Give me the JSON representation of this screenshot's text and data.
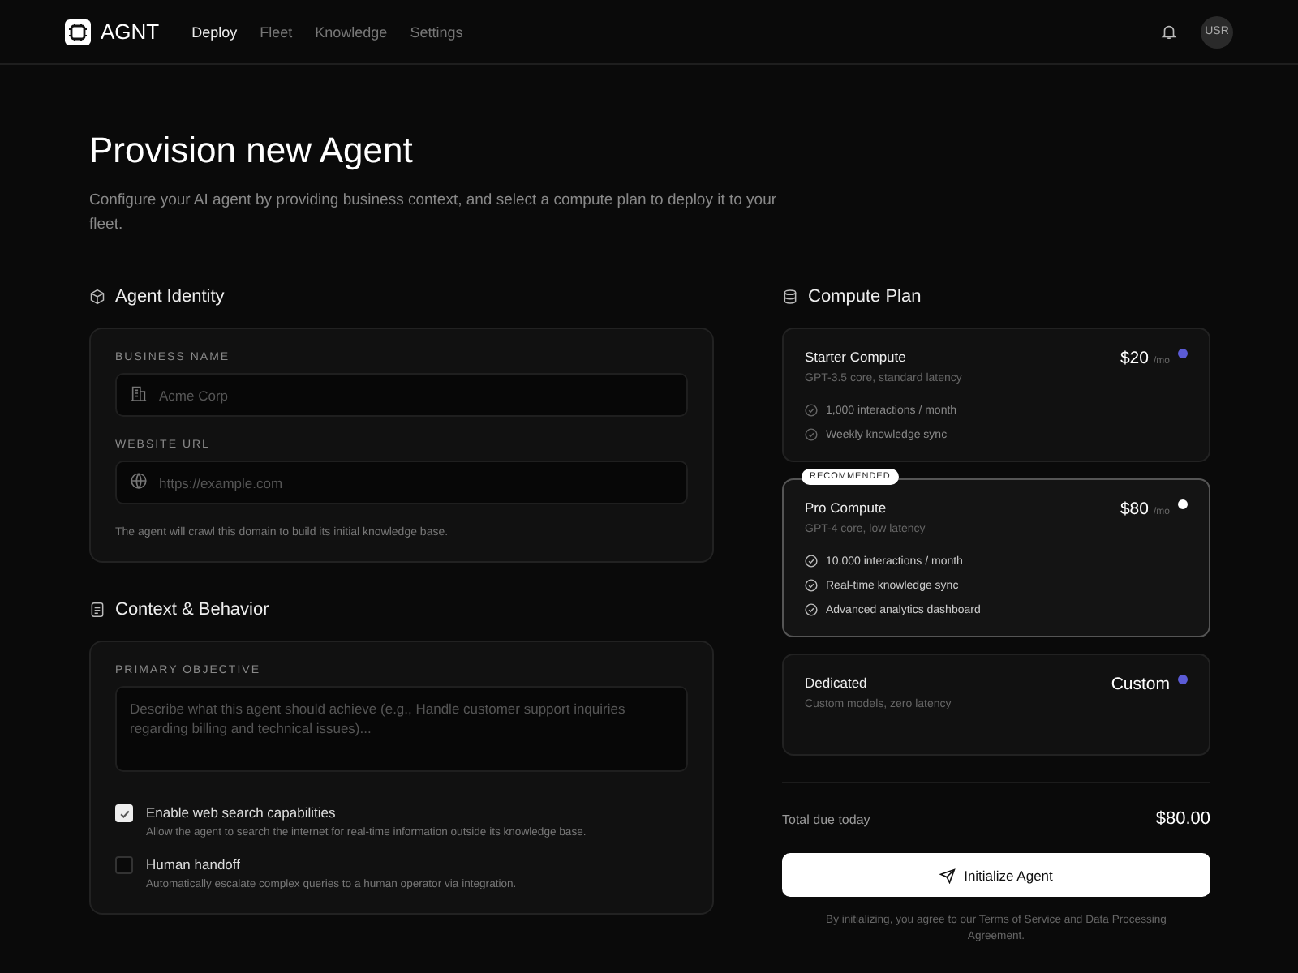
{
  "header": {
    "brand": "AGNT",
    "nav": [
      {
        "label": "Deploy",
        "selected": true
      },
      {
        "label": "Fleet",
        "selected": false
      },
      {
        "label": "Knowledge",
        "selected": false
      },
      {
        "label": "Settings",
        "selected": false
      }
    ],
    "avatar": "USR"
  },
  "page": {
    "title": "Provision new Agent",
    "subtitle": "Configure your AI agent by providing business context, and select a compute plan to deploy it to your fleet."
  },
  "identity": {
    "title": "Agent Identity",
    "fields": [
      {
        "label": "BUSINESS NAME",
        "placeholder": "Acme Corp",
        "kind": "building"
      },
      {
        "label": "WEBSITE URL",
        "placeholder": "https://example.com",
        "kind": "globe"
      }
    ],
    "hint": "The agent will crawl this domain to build its initial knowledge base."
  },
  "context": {
    "title": "Context & Behavior",
    "objective_label": "PRIMARY OBJECTIVE",
    "objective_placeholder": "Describe what this agent should achieve (e.g., Handle customer support inquiries regarding billing and technical issues)...",
    "options": [
      {
        "label": "Enable web search capabilities",
        "description": "Allow the agent to search the internet for real-time information outside its knowledge base.",
        "checked": true
      },
      {
        "label": "Human handoff",
        "description": "Automatically escalate complex queries to a human operator via integration.",
        "checked": false
      }
    ]
  },
  "compute": {
    "title": "Compute Plan",
    "plans": [
      {
        "name": "Starter Compute",
        "subtitle": "GPT-3.5 core, standard latency",
        "price": "$20",
        "unit": "/mo",
        "selected": false,
        "features": [
          "1,000 interactions / month",
          "Weekly knowledge sync"
        ]
      },
      {
        "name": "Pro Compute",
        "subtitle": "GPT-4 core, low latency",
        "price": "$80",
        "unit": "/mo",
        "selected": true,
        "badge": "RECOMMENDED",
        "features": [
          "10,000 interactions / month",
          "Real-time knowledge sync",
          "Advanced analytics dashboard"
        ]
      },
      {
        "name": "Dedicated",
        "subtitle": "Custom models, zero latency",
        "price": "Custom",
        "selected": false
      }
    ],
    "total_label": "Total due today",
    "total": "$80.00",
    "button": "Initialize Agent",
    "terms": "By initializing, you agree to our Terms of Service and Data Processing Agreement."
  }
}
